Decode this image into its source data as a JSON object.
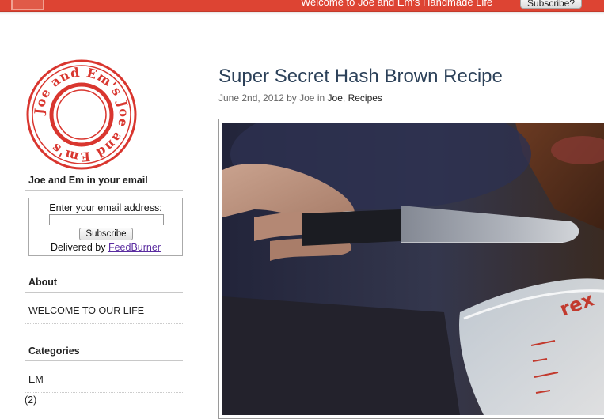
{
  "header": {
    "welcome": "Welcome to Joe and Em's Handmade Life",
    "subscribe_label": "Subscribe?"
  },
  "sidebar": {
    "logo_text": "Joe and Em's Joe and Em's",
    "email_heading": "Joe and Em in your email",
    "email_form": {
      "label": "Enter your email address:",
      "input_value": "",
      "button_label": "Subscribe",
      "delivered_prefix": "Delivered by",
      "delivered_link": "FeedBurner"
    },
    "about_heading": "About",
    "about_link": "WELCOME TO OUR LIFE",
    "categories_heading": "Categories",
    "categories": [
      {
        "name": "EM",
        "count": "(2)"
      }
    ]
  },
  "post": {
    "title": "Super Secret Hash Brown Recipe",
    "date": "June 2nd, 2012",
    "by": "by",
    "author": "Joe",
    "in": "in",
    "categories": [
      "Joe",
      "Recipes"
    ],
    "cat_sep": ",",
    "image_brand_text": "rex"
  },
  "colors": {
    "topbar": "#dd4433",
    "title": "#2c4159",
    "stamp": "#d9362f",
    "link_visited": "#5a2ca0"
  }
}
